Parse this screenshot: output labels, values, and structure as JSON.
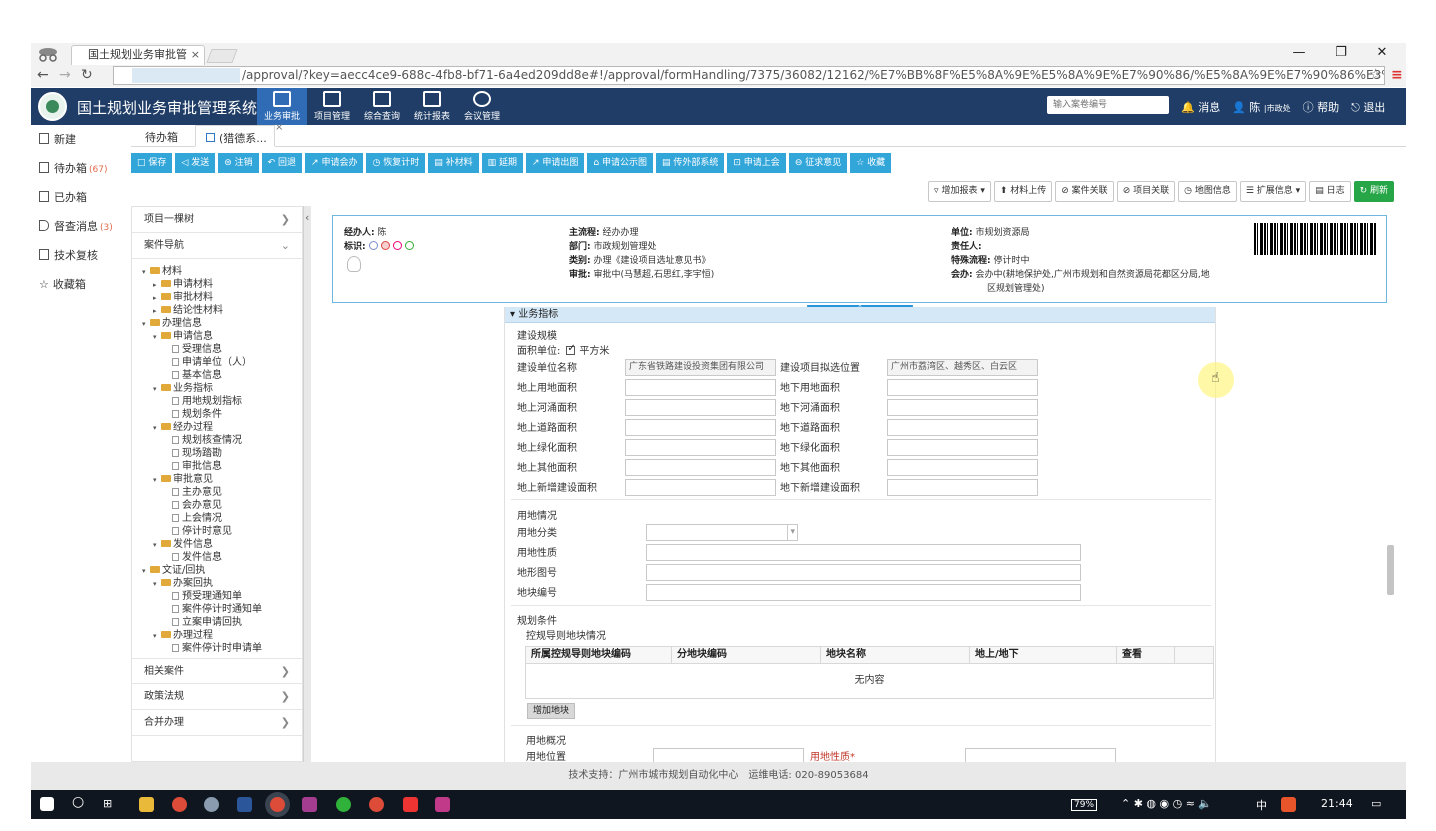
{
  "browser": {
    "tab_title": "国土规划业务审批管",
    "url": "/approval/?key=aecc4ce9-688c-4fb8-bf71-6a4ed209dd8e#!/approval/formHandling/7375/36082/12162/%E7%BB%8F%E5%8A%9E%E5%8A%9E%E7%90%86/%E5%8A%9E%E7%90%86%E3%80%8A%E5%BB%BA"
  },
  "app": {
    "title": "国土规划业务审批管理系统",
    "nav": [
      "业务审批",
      "项目管理",
      "综合查询",
      "统计报表",
      "会议管理"
    ],
    "search_placeholder": "输入案卷编号",
    "links": [
      "消息",
      "陈",
      "|市政处",
      "帮助",
      "退出"
    ]
  },
  "sidebar": [
    {
      "label": "新建",
      "count": ""
    },
    {
      "label": "待办箱",
      "count": "(67)"
    },
    {
      "label": "已办箱",
      "count": ""
    },
    {
      "label": "督查消息",
      "count": "(3)"
    },
    {
      "label": "技术复核",
      "count": ""
    },
    {
      "label": "收藏箱",
      "count": ""
    }
  ],
  "page_tabs": {
    "inbox": "待办箱",
    "current": "(猎德系..."
  },
  "toolbar1": [
    "保存",
    "发送",
    "注销",
    "回退",
    "申请会办",
    "恢复计时",
    "补材料",
    "延期",
    "申请出图",
    "申请公示图",
    "传外部系统",
    "申请上会",
    "征求意见",
    "收藏"
  ],
  "toolbar2": [
    "增加报表",
    "材料上传",
    "案件关联",
    "项目关联",
    "地图信息",
    "扩展信息",
    "日志",
    "刷新"
  ],
  "tree": {
    "top_sections": [
      "项目一棵树",
      "案件导航"
    ],
    "nodes": [
      {
        "label": "材料",
        "type": "folder",
        "level": 0
      },
      {
        "label": "申请材料",
        "type": "folder",
        "level": 1
      },
      {
        "label": "审批材料",
        "type": "folder",
        "level": 1
      },
      {
        "label": "结论性材料",
        "type": "folder",
        "level": 1
      },
      {
        "label": "办理信息",
        "type": "folder",
        "level": 0
      },
      {
        "label": "申请信息",
        "type": "folder",
        "level": 1
      },
      {
        "label": "受理信息",
        "type": "file",
        "level": 2
      },
      {
        "label": "申请单位（人）",
        "type": "file",
        "level": 2
      },
      {
        "label": "基本信息",
        "type": "file",
        "level": 2
      },
      {
        "label": "业务指标",
        "type": "folder",
        "level": 1
      },
      {
        "label": "用地规划指标",
        "type": "file",
        "level": 2
      },
      {
        "label": "规划条件",
        "type": "file",
        "level": 2
      },
      {
        "label": "经办过程",
        "type": "folder",
        "level": 1
      },
      {
        "label": "规划核查情况",
        "type": "file",
        "level": 2
      },
      {
        "label": "现场踏勘",
        "type": "file",
        "level": 2
      },
      {
        "label": "审批信息",
        "type": "file",
        "level": 2
      },
      {
        "label": "审批意见",
        "type": "folder",
        "level": 1
      },
      {
        "label": "主办意见",
        "type": "file",
        "level": 2
      },
      {
        "label": "会办意见",
        "type": "file",
        "level": 2
      },
      {
        "label": "上会情况",
        "type": "file",
        "level": 2
      },
      {
        "label": "停计时意见",
        "type": "file",
        "level": 2
      },
      {
        "label": "发件信息",
        "type": "folder",
        "level": 1
      },
      {
        "label": "发件信息",
        "type": "file",
        "level": 2
      },
      {
        "label": "文证/回执",
        "type": "folder",
        "level": 0
      },
      {
        "label": "办案回执",
        "type": "folder",
        "level": 1
      },
      {
        "label": "预受理通知单",
        "type": "file",
        "level": 2
      },
      {
        "label": "案件停计时通知单",
        "type": "file",
        "level": 2
      },
      {
        "label": "立案申请回执",
        "type": "file",
        "level": 2
      },
      {
        "label": "办理过程",
        "type": "folder",
        "level": 1
      },
      {
        "label": "案件停计时申请单",
        "type": "file",
        "level": 2
      }
    ],
    "bottom_sections": [
      "相关案件",
      "政策法规",
      "合并办理"
    ]
  },
  "info": {
    "handler_label": "经办人:",
    "handler_value": "陈",
    "mark_label": "标识:",
    "main_flow_label": "主流程:",
    "main_flow_value": "经办办理",
    "dept_label": "部门:",
    "dept_value": "市政规划管理处",
    "type_label": "类别:",
    "type_value": "办理《建设项目选址意见书》",
    "approval_label": "审批:",
    "approval_value": "审批中(马慧超,石思红,李宇恒)",
    "unit_label": "单位:",
    "unit_value": "市规划资源局",
    "resp_label": "责任人:",
    "resp_value": "",
    "special_label": "特殊流程:",
    "special_value": "停计时中",
    "co_label": "会办:",
    "co_value_1": "会办中(耕地保护处,广州市规划和自然资源局花都区分局,地",
    "co_value_2": "区规划管理处)"
  },
  "form": {
    "section_title": "业务指标",
    "group1": "建设规模",
    "area_unit_label": "面积单位:",
    "area_unit_value": "平方米",
    "rows": [
      {
        "l1": "建设单位名称",
        "v1": "广东省铁路建设投资集团有限公司",
        "l2": "建设项目拟选位置",
        "v2": "广州市荔湾区、越秀区、白云区"
      },
      {
        "l1": "地上用地面积",
        "v1": "",
        "l2": "地下用地面积",
        "v2": ""
      },
      {
        "l1": "地上河涌面积",
        "v1": "",
        "l2": "地下河涌面积",
        "v2": ""
      },
      {
        "l1": "地上道路面积",
        "v1": "",
        "l2": "地下道路面积",
        "v2": ""
      },
      {
        "l1": "地上绿化面积",
        "v1": "",
        "l2": "地下绿化面积",
        "v2": ""
      },
      {
        "l1": "地上其他面积",
        "v1": "",
        "l2": "地下其他面积",
        "v2": ""
      },
      {
        "l1": "地上新增建设面积",
        "v1": "",
        "l2": "地下新增建设面积",
        "v2": ""
      }
    ],
    "group2": "用地情况",
    "land_rows": [
      "用地分类",
      "用地性质",
      "地形图号",
      "地块编号"
    ],
    "group3": "规划条件",
    "sub3": "控规导则地块情况",
    "table_headers": [
      "所属控规导则地块编码",
      "分地块编码",
      "地块名称",
      "地上/地下",
      "查看"
    ],
    "table_empty": "无内容",
    "add_button": "增加地块",
    "group4": "用地概况",
    "partial_label_1": "用地位置",
    "partial_label_2": "用地性质*"
  },
  "footer": "技术支持：广州市城市规划自动化中心　运维电话: 020-89053684",
  "taskbar": {
    "battery": "79%",
    "ime": "中",
    "time": "21:44"
  }
}
